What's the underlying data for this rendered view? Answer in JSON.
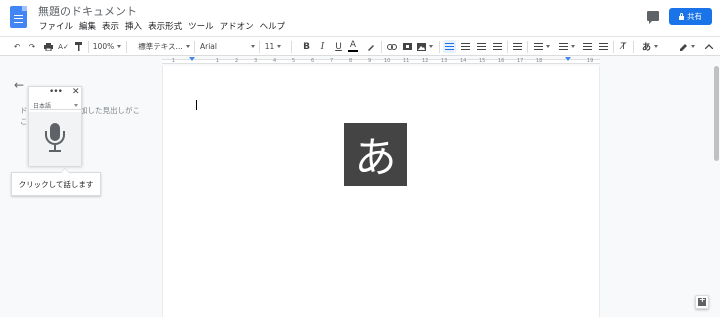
{
  "header": {
    "doc_title": "無題のドキュメント",
    "menu": [
      "ファイル",
      "編集",
      "表示",
      "挿入",
      "表示形式",
      "ツール",
      "アドオン",
      "ヘルプ"
    ],
    "share_label": "共有"
  },
  "toolbar": {
    "zoom": "100%",
    "style": "標準テキス...",
    "font": "Arial",
    "font_size": "11",
    "bold": "B",
    "italic": "I",
    "underline": "U",
    "text_color": "A",
    "input_tool": "あ"
  },
  "ruler": {
    "labels": [
      "1",
      "1",
      "2",
      "3",
      "4",
      "5",
      "6",
      "7",
      "8",
      "9",
      "10",
      "11",
      "12",
      "13",
      "14",
      "15",
      "16",
      "17",
      "18",
      "19"
    ]
  },
  "outline": {
    "hint": "ドキュメントに追加した見出しがここに表示されます。"
  },
  "voice_typing": {
    "language": "日本語",
    "tooltip": "クリックして話します"
  },
  "document": {
    "ime_char": "あ"
  },
  "colors": {
    "accent": "#1a73e8",
    "doc_icon": "#4285f4",
    "ime_block": "#444444"
  },
  "icons": [
    "docs-icon",
    "comment-icon",
    "lock-icon",
    "undo-icon",
    "redo-icon",
    "print-icon",
    "spellcheck-icon",
    "paint-format-icon",
    "link-icon",
    "insert-comment-icon",
    "image-icon",
    "align-left-icon",
    "align-center-icon",
    "align-right-icon",
    "justify-icon",
    "line-spacing-icon",
    "numbered-list-icon",
    "bulleted-list-icon",
    "decrease-indent-icon",
    "increase-indent-icon",
    "clear-formatting-icon",
    "pen-icon",
    "collapse-icon",
    "back-arrow-icon",
    "microphone-icon",
    "more-icon",
    "close-icon",
    "explore-icon"
  ]
}
